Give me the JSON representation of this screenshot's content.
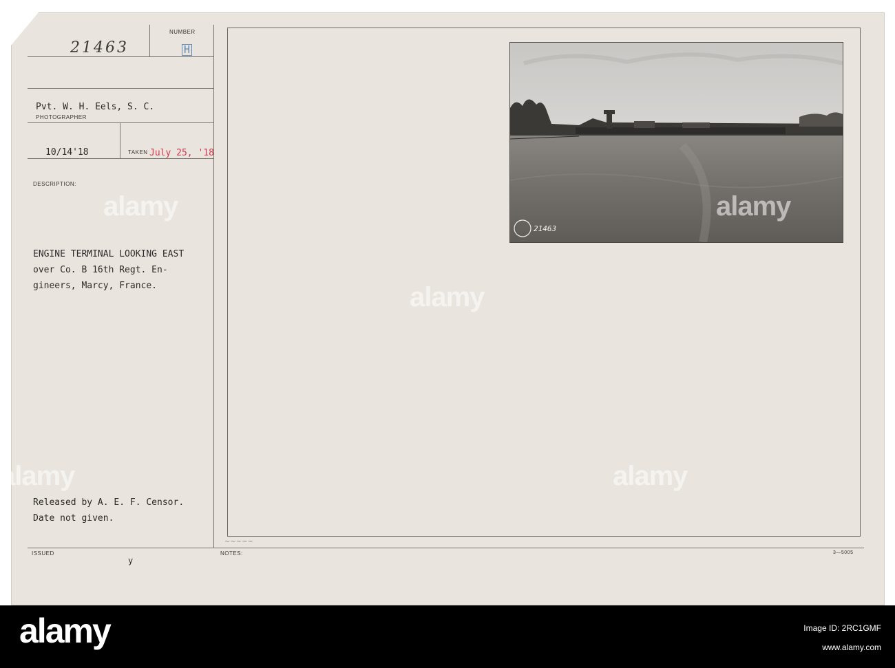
{
  "card": {
    "labels": {
      "number": "NUMBER",
      "photographer": "PHOTOGRAPHER",
      "taken": "TAKEN",
      "description": "DESCRIPTION:",
      "issued": "ISSUED",
      "notes": "NOTES:"
    },
    "record_number": "21463",
    "letter_stamp": "H",
    "photographer": "Pvt. W. H. Eels, S. C.",
    "received_date": "10/14'18",
    "taken_date": "July 25, '18",
    "description_lines": [
      "ENGINE TERMINAL LOOKING EAST",
      "over Co. B 16th Regt. En-",
      "gineers, Marcy, France."
    ],
    "release_lines": [
      "Released by A. E. F. Censor.",
      "Date not given."
    ],
    "issued_mark": "y",
    "form_code": "3—5005",
    "photo_stamp_number": "21463"
  },
  "watermark": {
    "text": "alamy"
  },
  "footer": {
    "logo": "alamy",
    "image_id": "Image ID: 2RC1GMF",
    "url": "www.alamy.com"
  },
  "colors": {
    "card": "#e9e4de",
    "red_stamp": "#d2394c",
    "blue_stamp": "#5b86b5",
    "footer": "#000000"
  }
}
